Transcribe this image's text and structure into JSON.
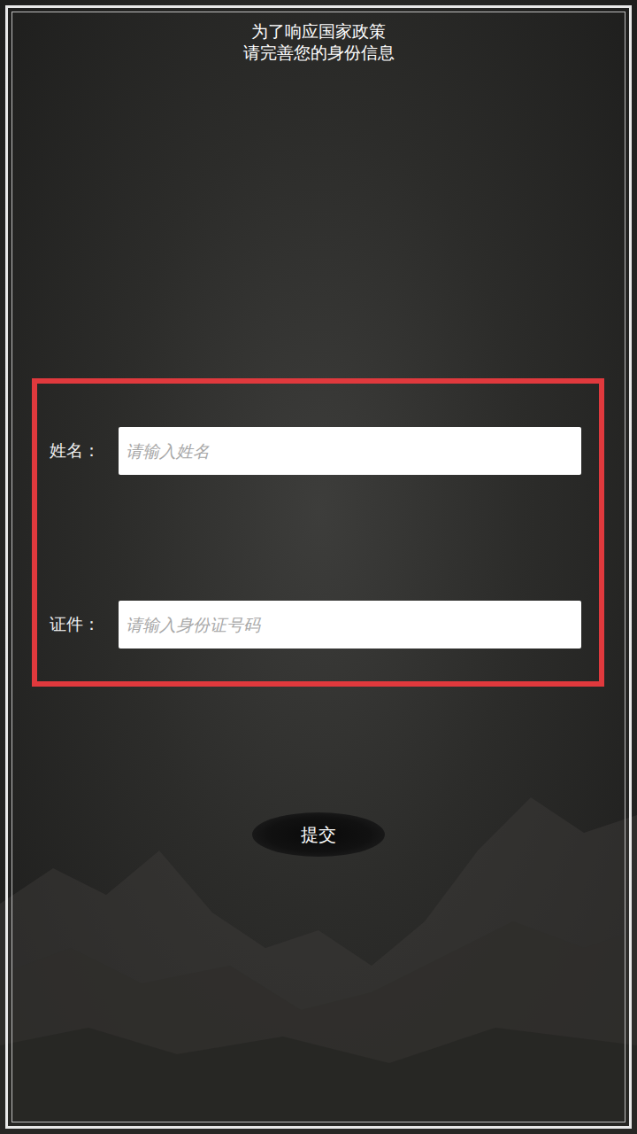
{
  "header": {
    "lines": [
      "为了响应国家政策",
      "请完善您的身份信息"
    ]
  },
  "form": {
    "fields": [
      {
        "label": "姓名：",
        "placeholder": "请输入姓名"
      },
      {
        "label": "证件：",
        "placeholder": "请输入身份证号码"
      }
    ]
  },
  "buttons": {
    "submit": "提交"
  }
}
